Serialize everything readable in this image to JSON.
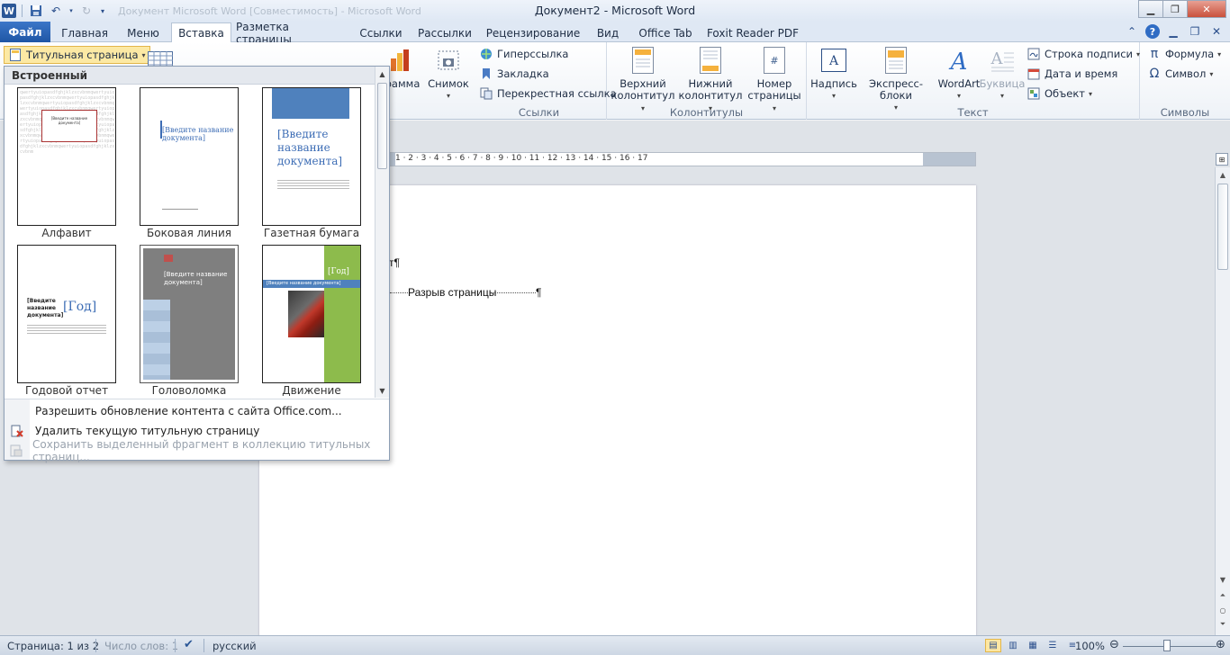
{
  "window": {
    "title": "Документ2 - Microsoft Word",
    "qat_faded_title": "Документ Microsoft Word [Совместимость] - Microsoft Word"
  },
  "tabs": [
    {
      "label": "Файл"
    },
    {
      "label": "Главная"
    },
    {
      "label": "Меню"
    },
    {
      "label": "Вставка"
    },
    {
      "label": "Разметка страницы"
    },
    {
      "label": "Ссылки"
    },
    {
      "label": "Рассылки"
    },
    {
      "label": "Рецензирование"
    },
    {
      "label": "Вид"
    },
    {
      "label": "Office Tab"
    },
    {
      "label": "Foxit Reader PDF"
    }
  ],
  "ribbon": {
    "cover_page_button": "Титульная страница",
    "illustrations": {
      "diagram_partial": "грамма",
      "screenshot": "Снимок"
    },
    "links": {
      "group_label": "Ссылки",
      "hyperlink": "Гиперссылка",
      "bookmark": "Закладка",
      "crossref": "Перекрестная ссылка"
    },
    "headers": {
      "group_label": "Колонтитулы",
      "header_l1": "Верхний",
      "header_l2": "колонтитул",
      "footer_l1": "Нижний",
      "footer_l2": "колонтитул",
      "pagenum_l1": "Номер",
      "pagenum_l2": "страницы"
    },
    "text": {
      "group_label": "Текст",
      "textbox": "Надпись",
      "quickparts": "Экспресс-блоки",
      "wordart": "WordArt",
      "dropcap": "Буквица",
      "signature": "Строка подписи",
      "datetime": "Дата и время",
      "object": "Объект"
    },
    "symbols": {
      "group_label": "Символы",
      "equation": "Формула",
      "symbol": "Символ"
    }
  },
  "gallery": {
    "header": "Встроенный",
    "items": [
      {
        "label": "Алфавит"
      },
      {
        "label": "Боковая линия"
      },
      {
        "label": "Газетная бумага"
      },
      {
        "label": "Годовой отчет"
      },
      {
        "label": "Головоломка"
      },
      {
        "label": "Движение"
      }
    ],
    "thumb_text": {
      "enter_title": "[Введите название документа]",
      "enter_title_l1": "[Введите",
      "enter_title_l2": "название",
      "enter_title_l3": "документа]",
      "year": "[Год]"
    },
    "menu": [
      {
        "label": "Разрешить обновление контента с сайта Office.com..."
      },
      {
        "label": "Удалить текущую титульную страницу"
      },
      {
        "label": "Сохранить выделенный фрагмент в коллекцию титульных страниц..."
      }
    ]
  },
  "document": {
    "pilcrow_fragment": "т¶",
    "page_break": "Разрыв страницы",
    "pilcrow": "¶",
    "ruler_numbers": "1 · 2 · 3 · 4 · 5 · 6 · 7 · 8 · 9 · 10 · 11 · 12 · 13 · 14 · 15 · 16 · 17"
  },
  "status": {
    "page": "Страница: 1 из 2",
    "words": "Число слов: 1",
    "language": "русский",
    "zoom": "100%"
  }
}
